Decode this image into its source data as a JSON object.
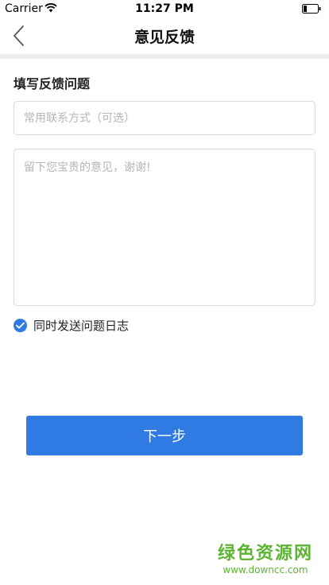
{
  "status_bar": {
    "carrier": "Carrier",
    "time": "11:27 PM"
  },
  "nav": {
    "title": "意见反馈",
    "back_icon": "chevron-left-icon"
  },
  "form": {
    "section_title": "填写反馈问题",
    "contact_placeholder": "常用联系方式（可选）",
    "feedback_placeholder": "留下您宝贵的意见，谢谢!",
    "send_log_label": "同时发送问题日志",
    "send_log_checked": true,
    "next_label": "下一步"
  },
  "watermark": {
    "title": "绿色资源网",
    "url": "www.downcc.com"
  },
  "colors": {
    "accent": "#2f7be3",
    "watermark": "#5cb531",
    "divider": "#eeeeee"
  }
}
